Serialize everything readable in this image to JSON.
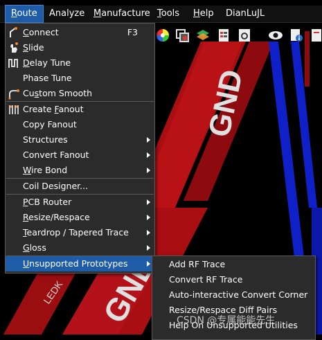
{
  "menubar": {
    "items": [
      {
        "label": "Route",
        "underline": "R"
      },
      {
        "label": "Analyze"
      },
      {
        "label": "Manufacture",
        "underline": "M"
      },
      {
        "label": "Tools",
        "underline": "T"
      },
      {
        "label": "Help",
        "underline": "H"
      },
      {
        "label": "DianLuJL"
      }
    ]
  },
  "route_menu": {
    "items": [
      {
        "label": "Connect",
        "shortcut": "F3",
        "icon": "connect-icon"
      },
      {
        "label": "Slide",
        "icon": "slide-icon"
      },
      {
        "label": "Delay Tune",
        "icon": "delay-tune-icon"
      },
      {
        "label": "Phase Tune"
      },
      {
        "label": "Custom Smooth",
        "icon": "custom-smooth-icon"
      },
      {
        "label": "Create Fanout",
        "icon": "fanout-icon"
      },
      {
        "label": "Copy Fanout"
      },
      {
        "label": "Structures",
        "submenu": true
      },
      {
        "label": "Convert Fanout",
        "submenu": true
      },
      {
        "label": "Wire Bond",
        "submenu": true
      },
      {
        "label": "Coil Designer..."
      },
      {
        "label": "PCB Router",
        "submenu": true
      },
      {
        "label": "Resize/Respace",
        "submenu": true
      },
      {
        "label": "Teardrop / Tapered Trace",
        "submenu": true
      },
      {
        "label": "Gloss",
        "submenu": true
      },
      {
        "label": "Unsupported Prototypes",
        "submenu": true,
        "active": true
      }
    ]
  },
  "unsupported_prototypes_submenu": {
    "items": [
      {
        "label": "Add RF Trace"
      },
      {
        "label": "Convert RF Trace"
      },
      {
        "label": "Auto-interactive Convert Corner"
      },
      {
        "label": "Resize/Respace Diff Pairs"
      },
      {
        "label": "Help On Unsupported Utilities"
      }
    ]
  },
  "canvas": {
    "labels": [
      "GND",
      "GND",
      "GND",
      "LEDK"
    ],
    "colors": {
      "trace_red": "#b40f14",
      "trace_blue": "#1020c8",
      "accent": "#1e5ca8"
    }
  },
  "watermark": "CSDN @专属能能先生"
}
